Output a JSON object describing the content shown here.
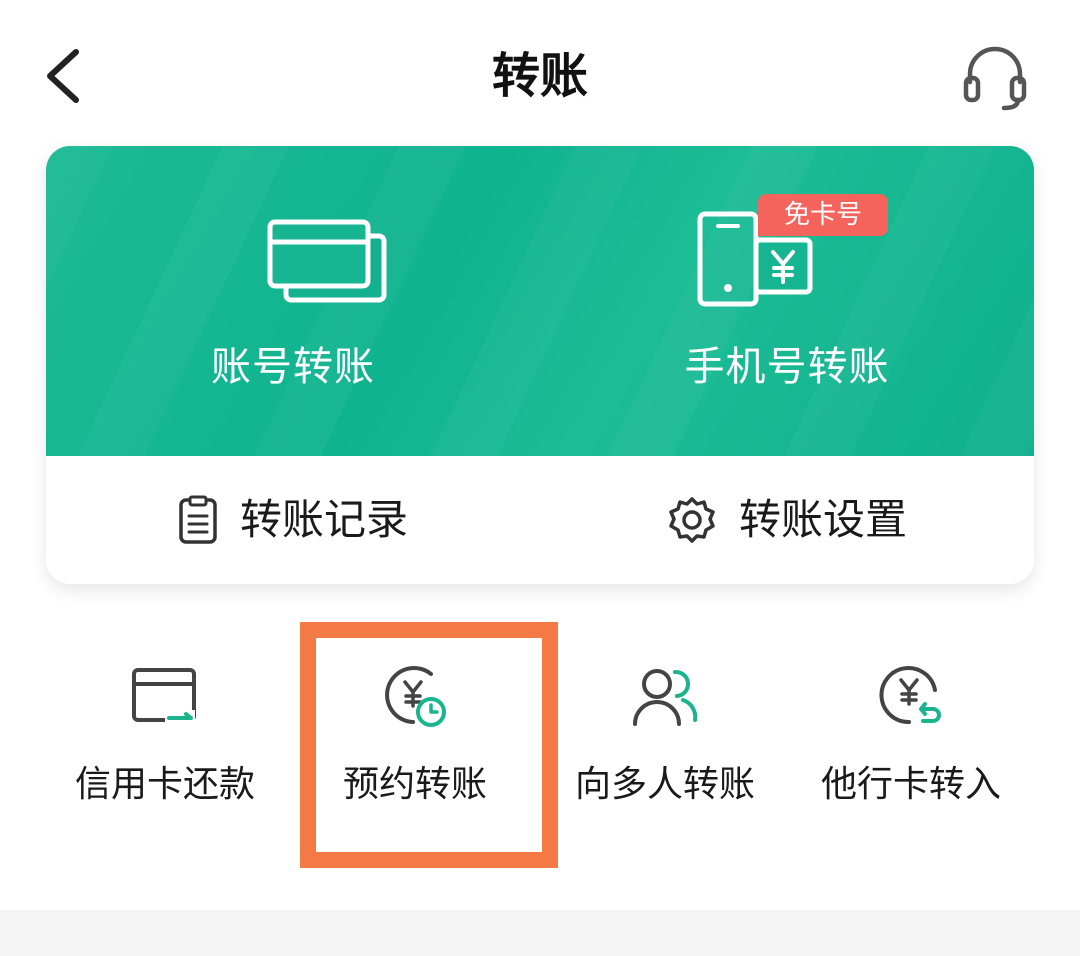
{
  "header": {
    "title": "转账",
    "back_icon": "chevron-left-icon",
    "support_icon": "headset-icon"
  },
  "card": {
    "actions": [
      {
        "label": "账号转账",
        "icon": "bank-cards-icon"
      },
      {
        "label": "手机号转账",
        "icon": "phone-yuan-icon",
        "badge": "免卡号"
      }
    ],
    "links": [
      {
        "label": "转账记录",
        "icon": "clipboard-icon"
      },
      {
        "label": "转账设置",
        "icon": "gear-icon"
      }
    ]
  },
  "features": [
    {
      "label": "信用卡还款",
      "icon": "credit-card-repay-icon"
    },
    {
      "label": "预约转账",
      "icon": "scheduled-transfer-icon"
    },
    {
      "label": "向多人转账",
      "icon": "multi-user-icon"
    },
    {
      "label": "他行卡转入",
      "icon": "inbound-transfer-icon"
    }
  ],
  "colors": {
    "brand_green": "#12b592",
    "badge_red": "#f4645c",
    "highlight_orange": "#f47a45"
  }
}
